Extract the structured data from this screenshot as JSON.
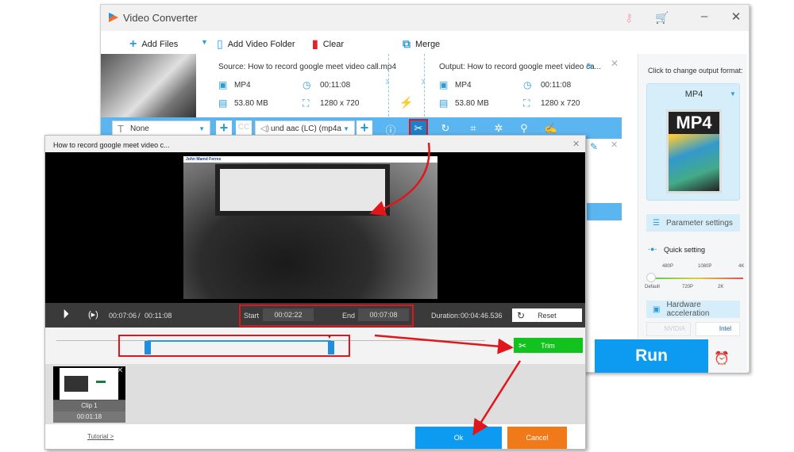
{
  "app": {
    "title": "Video Converter",
    "title_icons": [
      "key-icon",
      "cart-icon"
    ],
    "window_controls": {
      "minimize": "–",
      "close": "✕"
    }
  },
  "toolbar": {
    "add_files": "Add Files",
    "add_video_folder": "Add Video Folder",
    "clear": "Clear",
    "merge": "Merge"
  },
  "file": {
    "source_label": "Source: How to record google meet video call.mp4",
    "output_label": "Output: How to record google meet video ca...",
    "source": {
      "format": "MP4",
      "duration": "00:11:08",
      "size": "53.80 MB",
      "resolution": "1280 x 720"
    },
    "output": {
      "format": "MP4",
      "duration": "00:11:08",
      "size": "53.80 MB",
      "resolution": "1280 x 720"
    }
  },
  "edit_bar": {
    "subtitle_value": "None",
    "audio_value": "und aac (LC) (mp4a",
    "icons": [
      "info-icon",
      "scissors-icon",
      "rotate-icon",
      "crop-icon",
      "effects-icon",
      "watermark-icon",
      "subtitle-edit-icon"
    ]
  },
  "sidebar": {
    "output_format_hint": "Click to change output format:",
    "format": "MP4",
    "format_image_label": "MP4",
    "parameter_settings": "Parameter settings",
    "quick_setting": "Quick setting",
    "quality_top": [
      "480P",
      "1080P",
      "4K"
    ],
    "quality_bottom": [
      "Default",
      "720P",
      "2K"
    ],
    "quality_selected": "Default",
    "hardware_acceleration": "Hardware acceleration",
    "nvidia": "NVIDIA",
    "intel": "Intel",
    "run": "Run"
  },
  "trim_dialog": {
    "title": "How to record google meet video c...",
    "video_overlay_name": "John Mamd Ferres",
    "current_time": "00:07:06",
    "separator": "/",
    "total_time": "00:11:08",
    "start_label": "Start",
    "start_value": "00:02:22",
    "end_label": "End",
    "end_value": "00:07:08",
    "duration_label": "Duration:",
    "duration_value": "00:04:46.536",
    "reset": "Reset",
    "trim": "Trim",
    "selection_start_fraction": 0.2126,
    "selection_end_fraction": 0.6407,
    "clips": [
      {
        "label": "Clip 1",
        "duration": "00:01:18"
      }
    ],
    "tutorial_link": "Tutorial >",
    "ok": "Ok",
    "cancel": "Cancel"
  },
  "colors": {
    "accent_blue": "#0d9bf2",
    "edit_bar_blue": "#5ab5f0",
    "trim_green": "#12c21e",
    "cancel_orange": "#f07a1a",
    "highlight_red": "#e0161b"
  }
}
